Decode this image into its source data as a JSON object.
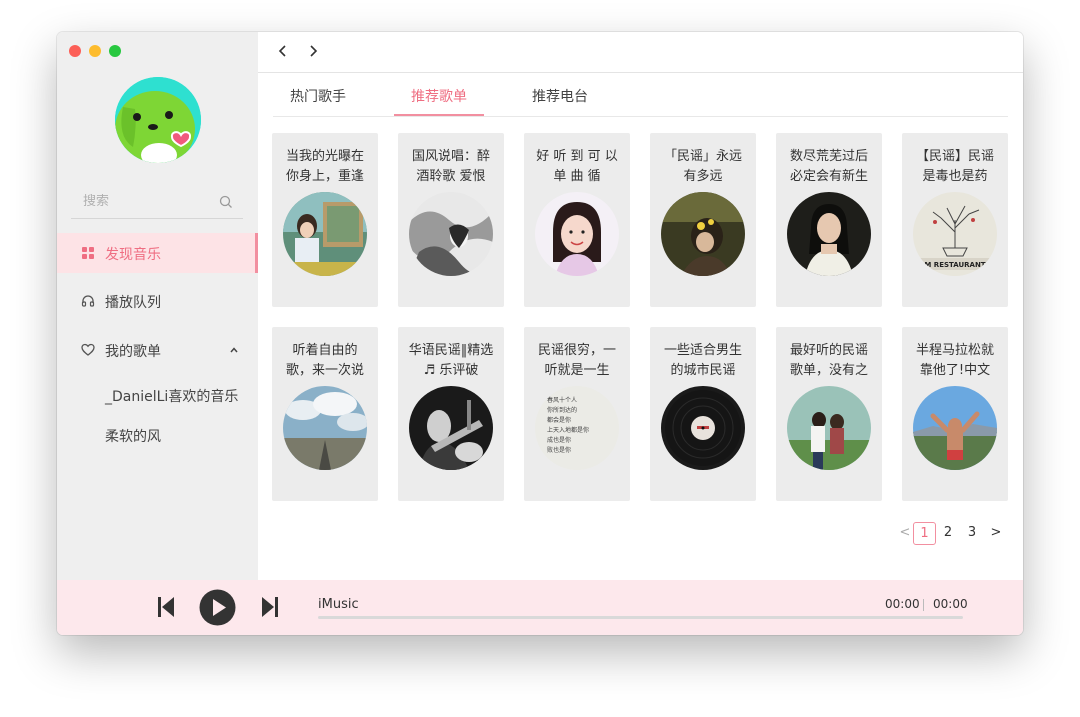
{
  "app": {
    "name": "iMusic"
  },
  "sidebar": {
    "search_placeholder": "搜索",
    "nav": [
      {
        "label": "发现音乐",
        "icon": "grid-icon",
        "active": true
      },
      {
        "label": "播放队列",
        "icon": "headphones-icon",
        "active": false
      },
      {
        "label": "我的歌单",
        "icon": "heart-icon",
        "active": false,
        "expanded": true
      }
    ],
    "playlists": [
      "_DanielLi喜欢的音乐",
      "柔软的风"
    ]
  },
  "tabs": [
    {
      "label": "热门歌手",
      "active": false
    },
    {
      "label": "推荐歌单",
      "active": true
    },
    {
      "label": "推荐电台",
      "active": false
    }
  ],
  "cards": [
    {
      "title": "当我的光曝在你身上，重逢",
      "cover": "cover-girl-painting"
    },
    {
      "title": "国风说唱：醉酒聆歌 爱恨",
      "cover": "cover-ink-portrait"
    },
    {
      "title": "好 听 到 可 以 单 曲 循",
      "cover": "cover-smiling-girl"
    },
    {
      "title": "「民谣」永远有多远",
      "cover": "cover-flower-girl"
    },
    {
      "title": "数尽荒芜过后必定会有新生",
      "cover": "cover-dark-portrait"
    },
    {
      "title": "【民谣】民谣是毒也是药",
      "cover": "cover-tree-sketch"
    },
    {
      "title": "听着自由的歌，来一次说",
      "cover": "cover-sky-road"
    },
    {
      "title": "华语民谣‖精选♬ 乐评破",
      "cover": "cover-guitar-bw"
    },
    {
      "title": "民谣很穷，一听就是一生",
      "cover": "cover-handwritten-note"
    },
    {
      "title": "一些适合男生的城市民谣",
      "cover": "cover-vinyl"
    },
    {
      "title": "最好听的民谣歌单，没有之",
      "cover": "cover-couple"
    },
    {
      "title": "半程马拉松就靠他了!中文",
      "cover": "cover-runner"
    }
  ],
  "note_lines": [
    "春风十个人",
    "你所到达的",
    "都会是你",
    "上天入地都是你",
    "成也是你",
    "败也是你"
  ],
  "cover_text": {
    "restaurant": "M RESTAURANT"
  },
  "pagination": {
    "pages": [
      "1",
      "2",
      "3"
    ],
    "current": 1,
    "prev": "<",
    "next": ">"
  },
  "player": {
    "title": "iMusic",
    "elapsed": "00:00",
    "duration": "00:00",
    "progress": 0
  },
  "colors": {
    "accent": "#f28fa0",
    "accent_text": "#ef6e82",
    "sidebar_bg": "#efefef",
    "player_bg": "#fde8ec",
    "active_nav_bg": "#fde3e6"
  }
}
